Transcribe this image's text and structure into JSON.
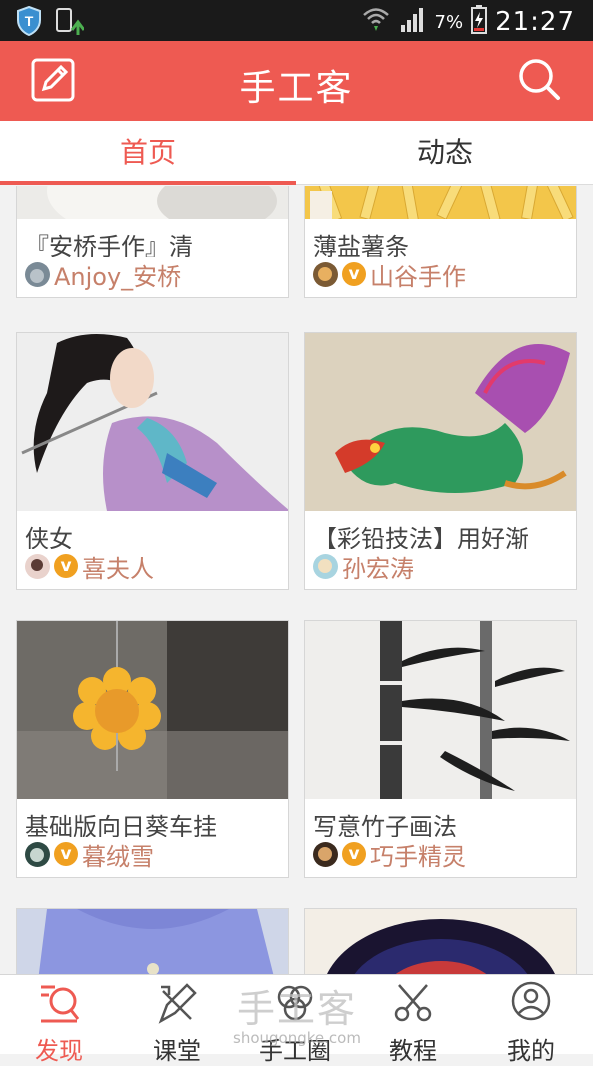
{
  "status_bar": {
    "battery_percent": "7%",
    "time": "21:27",
    "icons": [
      "shield-icon",
      "phone-update-icon",
      "wifi-icon",
      "signal-icon",
      "battery-charging-icon"
    ]
  },
  "header": {
    "title": "手工客",
    "left_icon": "edit-icon",
    "right_icon": "search-icon",
    "background": "#ee5a52"
  },
  "tabs": [
    {
      "label": "首页",
      "active": true
    },
    {
      "label": "动态",
      "active": false
    }
  ],
  "cards": [
    {
      "title": "『安桥手作』清",
      "author": "Anjoy_安桥",
      "verified": false,
      "image": "handmade-craft-photo"
    },
    {
      "title": "薄盐薯条",
      "author": "山谷手作",
      "verified": true,
      "image": "french-fries-photo"
    },
    {
      "title": "侠女",
      "author": "喜夫人",
      "verified": true,
      "image": "heroine-drawing"
    },
    {
      "title": "【彩铅技法】用好渐",
      "author": "孙宏涛",
      "verified": false,
      "image": "colored-pencil-dragon"
    },
    {
      "title": "基础版向日葵车挂",
      "author": "暮绒雪",
      "verified": true,
      "image": "felt-sunflower-ornament"
    },
    {
      "title": "写意竹子画法",
      "author": "巧手精灵",
      "verified": true,
      "image": "ink-bamboo-painting"
    },
    {
      "title": "",
      "author": "",
      "verified": false,
      "image": "blue-shirt-photo"
    },
    {
      "title": "",
      "author": "",
      "verified": false,
      "image": "galaxy-plate-photo"
    }
  ],
  "bottom_nav": [
    {
      "label": "发现",
      "icon": "discover-icon",
      "active": true
    },
    {
      "label": "课堂",
      "icon": "classroom-icon",
      "active": false
    },
    {
      "label": "手工圈",
      "icon": "circle-icon",
      "active": false
    },
    {
      "label": "教程",
      "icon": "tutorial-scissors-icon",
      "active": false
    },
    {
      "label": "我的",
      "icon": "profile-icon",
      "active": false
    }
  ],
  "watermark": {
    "text": "手工客",
    "url": "shougongke.com"
  },
  "colors": {
    "accent": "#ee5a52",
    "author": "#c6806a",
    "verified_badge": "#f0a020"
  }
}
